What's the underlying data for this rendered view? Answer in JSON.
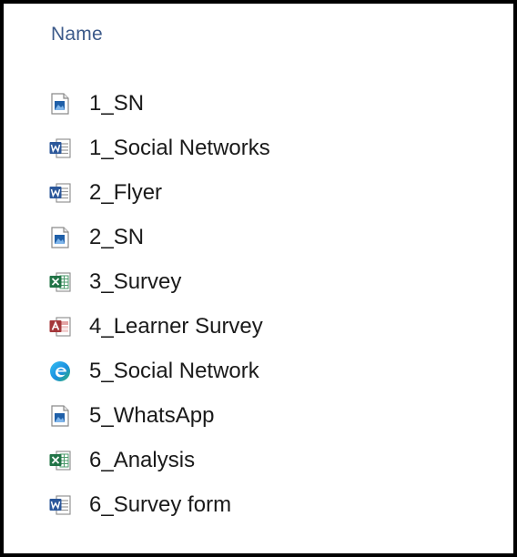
{
  "header": {
    "name_column": "Name"
  },
  "files": [
    {
      "name": "1_SN",
      "type": "image"
    },
    {
      "name": "1_Social Networks",
      "type": "word"
    },
    {
      "name": "2_Flyer",
      "type": "word"
    },
    {
      "name": "2_SN",
      "type": "image"
    },
    {
      "name": "3_Survey",
      "type": "excel"
    },
    {
      "name": "4_Learner Survey",
      "type": "access"
    },
    {
      "name": "5_Social Network",
      "type": "edge"
    },
    {
      "name": "5_WhatsApp",
      "type": "image"
    },
    {
      "name": "6_Analysis",
      "type": "excel"
    },
    {
      "name": "6_Survey form",
      "type": "word"
    }
  ],
  "colors": {
    "header_text": "#3c5a8a",
    "word_blue": "#2b579a",
    "excel_green": "#217346",
    "access_red": "#a4373a",
    "edge_teal": "#0c8fd6"
  }
}
